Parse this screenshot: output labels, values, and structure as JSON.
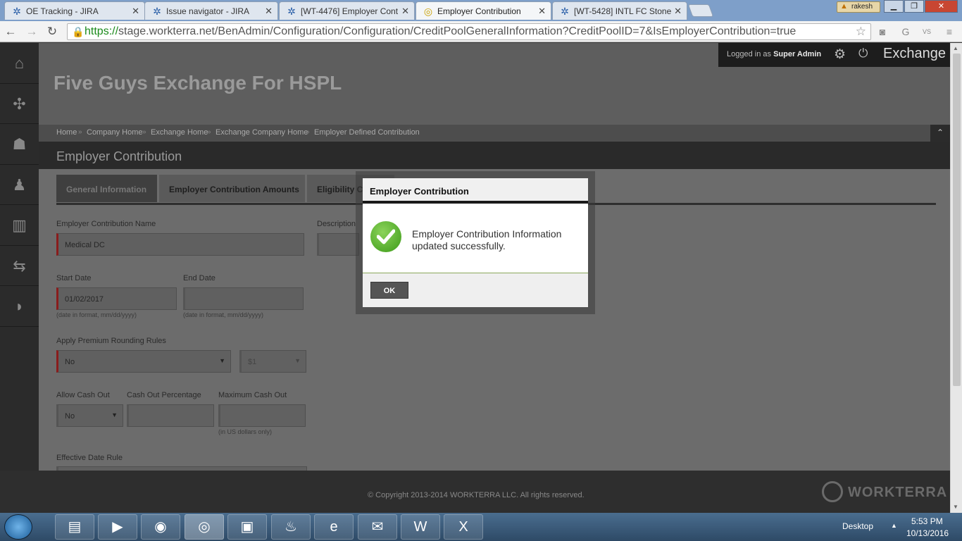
{
  "browser": {
    "tabs": [
      {
        "title": "OE Tracking - JIRA",
        "icon": "jira-icon"
      },
      {
        "title": "Issue navigator - JIRA",
        "icon": "jira-icon"
      },
      {
        "title": "[WT-4476] Employer Cont",
        "icon": "jira-icon"
      },
      {
        "title": "Employer Contribution",
        "icon": "workterra-icon"
      },
      {
        "title": "[WT-5428] INTL FC Stone",
        "icon": "jira-icon"
      }
    ],
    "user": "rakesh",
    "url_scheme": "https://",
    "url_rest": "stage.workterra.net/BenAdmin/Configuration/Configuration/CreditPoolGeneralInformation?CreditPoolID=7&IsEmployerContribution=true"
  },
  "app": {
    "site_title": "Five Guys Exchange For HSPL",
    "logged_prefix": "Logged in as",
    "logged_user": "Super Admin",
    "mode": "Exchange",
    "breadcrumb": [
      "Home",
      "Company Home",
      "Exchange Home",
      "Exchange Company Home",
      "Employer Defined Contribution"
    ],
    "page_title": "Employer Contribution",
    "tabs": [
      "General Information",
      "Employer Contribution Amounts",
      "Eligibility Cr"
    ],
    "form": {
      "name_label": "Employer Contribution Name",
      "name_value": "Medical DC",
      "description_label": "Description",
      "start_label": "Start Date",
      "start_value": "01/02/2017",
      "end_label": "End Date",
      "date_hint": "(date in format, mm/dd/yyyy)",
      "rounding_label": "Apply Premium Rounding Rules",
      "rounding_value": "No",
      "rounding_amount": "$1",
      "cashout_label": "Allow Cash Out",
      "cashout_value": "No",
      "cashout_pct_label": "Cash Out Percentage",
      "max_cashout_label": "Maximum Cash Out",
      "max_cashout_hint": "(in US dollars only)",
      "effective_label": "Effective Date Rule"
    },
    "footer_copyright": "© Copyright 2013-2014 WORKTERRA LLC. All rights reserved.",
    "footer_brand": "WORKTERRA"
  },
  "modal": {
    "title": "Employer Contribution",
    "message": "Employer Contribution Information updated successfully.",
    "ok_label": "OK"
  },
  "taskbar": {
    "desktop_label": "Desktop",
    "time": "5:53 PM",
    "date": "10/13/2016"
  },
  "colors": {
    "success": "#3c9a18",
    "required_marker": "#8a1c1c",
    "omnibox_secure": "#1a8a1a"
  }
}
